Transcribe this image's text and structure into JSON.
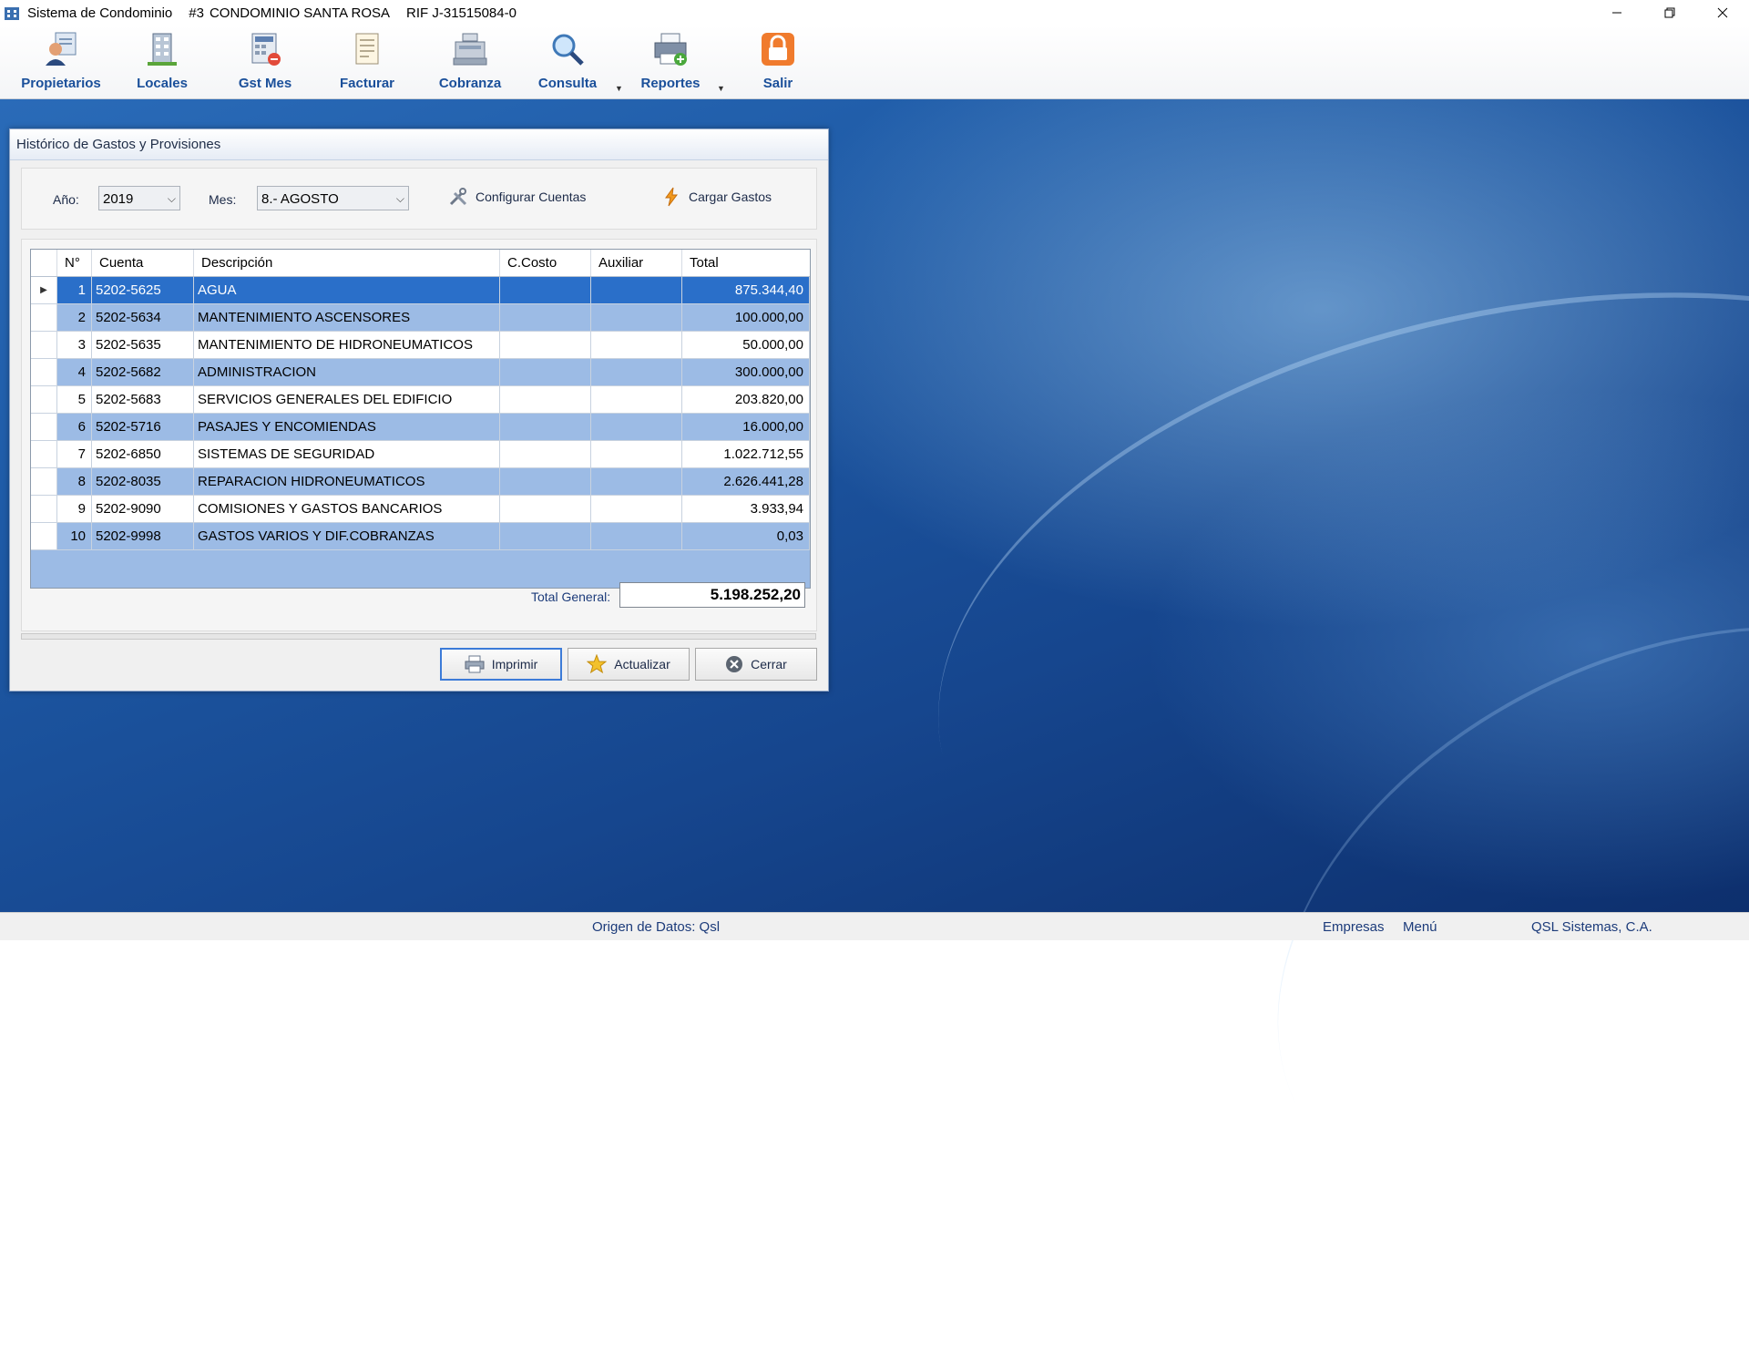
{
  "window": {
    "app_name": "Sistema de Condominio",
    "condo_number": "#3",
    "condo_name": "CONDOMINIO SANTA ROSA",
    "rif": "RIF J-31515084-0"
  },
  "toolbar": {
    "items": [
      {
        "label": "Propietarios",
        "icon": "owner-icon"
      },
      {
        "label": "Locales",
        "icon": "building-icon"
      },
      {
        "label": "Gst Mes",
        "icon": "calculator-icon"
      },
      {
        "label": "Facturar",
        "icon": "invoice-icon"
      },
      {
        "label": "Cobranza",
        "icon": "cash-register-icon"
      },
      {
        "label": "Consulta",
        "icon": "magnifier-icon"
      },
      {
        "label": "Reportes",
        "icon": "printer-icon"
      },
      {
        "label": "Salir",
        "icon": "lock-icon"
      }
    ]
  },
  "dialog": {
    "title": "Histórico de Gastos y Provisiones",
    "year_label": "Año:",
    "year_value": "2019",
    "month_label": "Mes:",
    "month_value": "8.- AGOSTO",
    "configure_label": "Configurar Cuentas",
    "load_label": "Cargar Gastos",
    "columns": [
      "N°",
      "Cuenta",
      "Descripción",
      "C.Costo",
      "Auxiliar",
      "Total"
    ],
    "rows": [
      {
        "n": "1",
        "cuenta": "5202-5625",
        "desc": "AGUA",
        "ccosto": "",
        "aux": "",
        "total": "875.344,40"
      },
      {
        "n": "2",
        "cuenta": "5202-5634",
        "desc": "MANTENIMIENTO ASCENSORES",
        "ccosto": "",
        "aux": "",
        "total": "100.000,00"
      },
      {
        "n": "3",
        "cuenta": "5202-5635",
        "desc": "MANTENIMIENTO DE HIDRONEUMATICOS",
        "ccosto": "",
        "aux": "",
        "total": "50.000,00"
      },
      {
        "n": "4",
        "cuenta": "5202-5682",
        "desc": "ADMINISTRACION",
        "ccosto": "",
        "aux": "",
        "total": "300.000,00"
      },
      {
        "n": "5",
        "cuenta": "5202-5683",
        "desc": "SERVICIOS GENERALES DEL EDIFICIO",
        "ccosto": "",
        "aux": "",
        "total": "203.820,00"
      },
      {
        "n": "6",
        "cuenta": "5202-5716",
        "desc": "PASAJES Y ENCOMIENDAS",
        "ccosto": "",
        "aux": "",
        "total": "16.000,00"
      },
      {
        "n": "7",
        "cuenta": "5202-6850",
        "desc": "SISTEMAS DE SEGURIDAD",
        "ccosto": "",
        "aux": "",
        "total": "1.022.712,55"
      },
      {
        "n": "8",
        "cuenta": "5202-8035",
        "desc": "REPARACION HIDRONEUMATICOS",
        "ccosto": "",
        "aux": "",
        "total": "2.626.441,28"
      },
      {
        "n": "9",
        "cuenta": "5202-9090",
        "desc": "COMISIONES Y GASTOS BANCARIOS",
        "ccosto": "",
        "aux": "",
        "total": "3.933,94"
      },
      {
        "n": "10",
        "cuenta": "5202-9998",
        "desc": "GASTOS VARIOS Y DIF.COBRANZAS",
        "ccosto": "",
        "aux": "",
        "total": "0,03"
      }
    ],
    "selected_row": 1,
    "total_label": "Total General:",
    "total_value": "5.198.252,20",
    "buttons": {
      "print": "Imprimir",
      "refresh": "Actualizar",
      "close": "Cerrar"
    }
  },
  "statusbar": {
    "source": "Origen de Datos: Qsl",
    "empresas": "Empresas",
    "menu": "Menú",
    "company": "QSL Sistemas, C.A."
  },
  "colors": {
    "accent": "#1a4f9a",
    "selected_row": "#2a6fc9",
    "alt_row": "#9cbbe5"
  }
}
